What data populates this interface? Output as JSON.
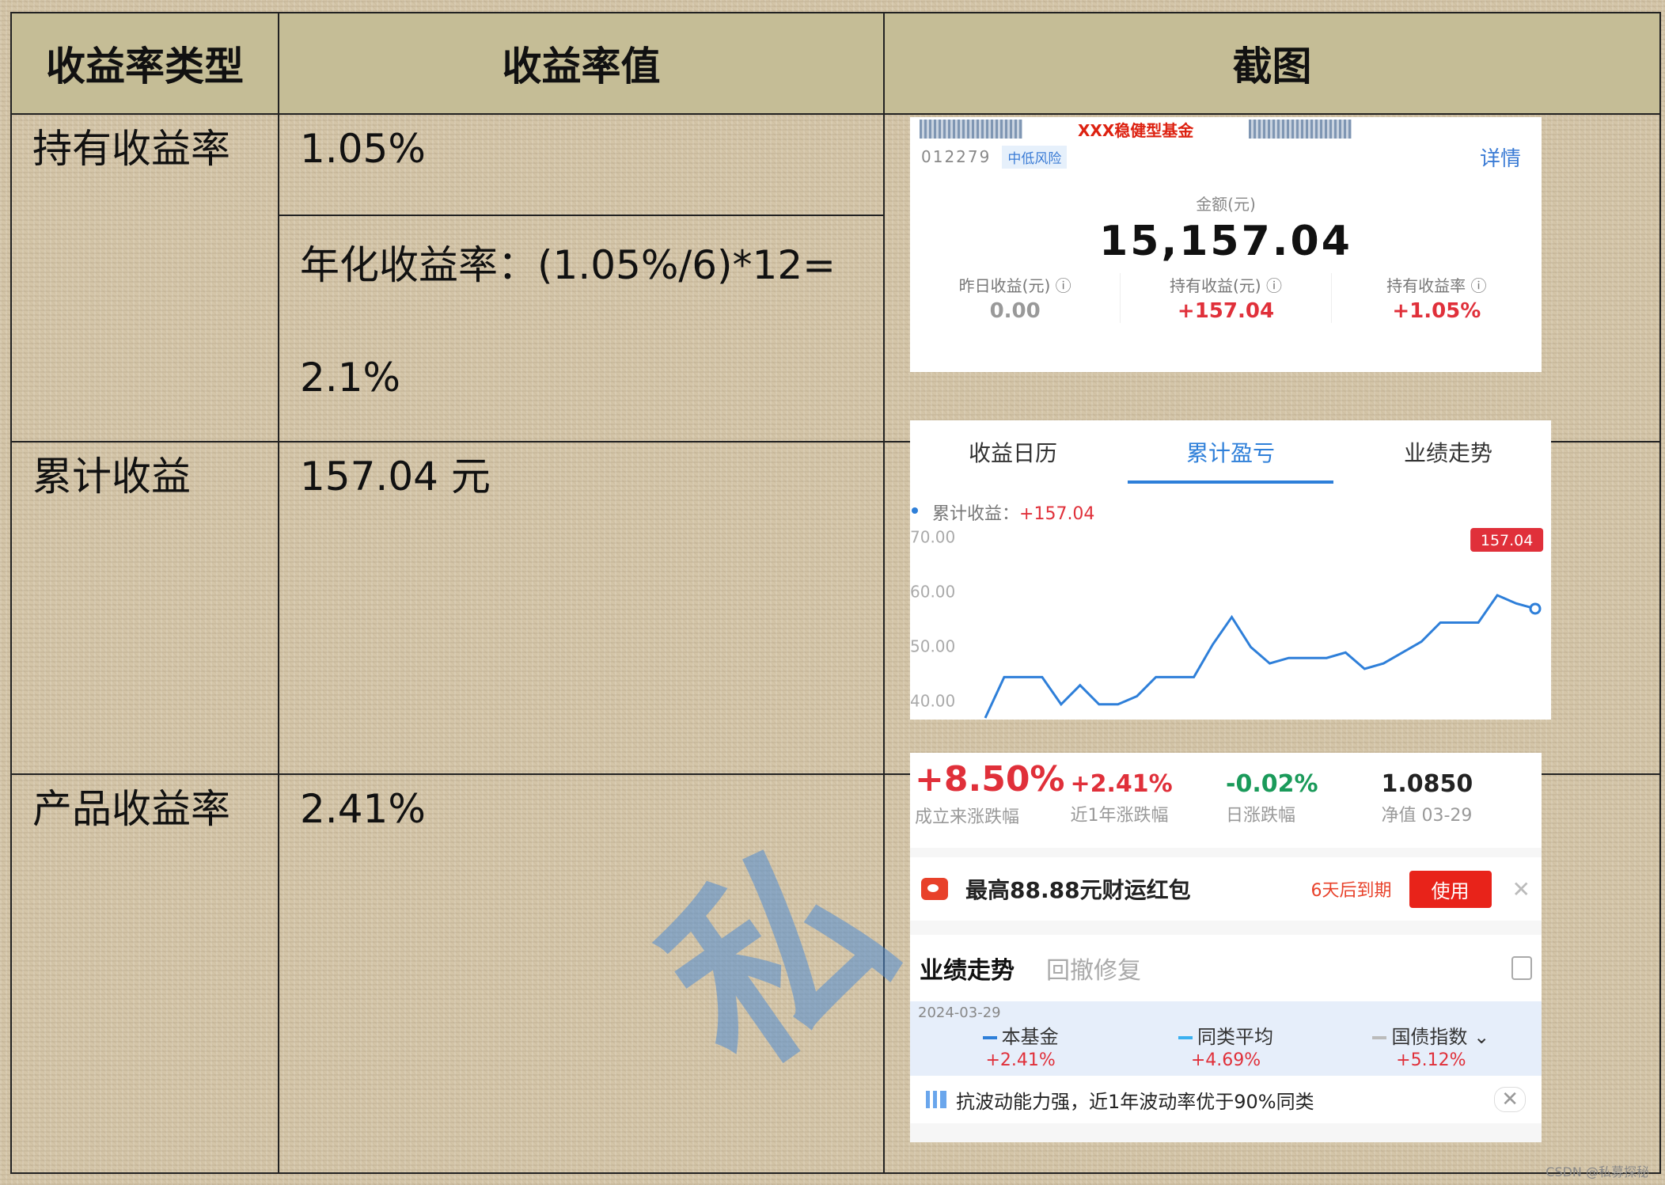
{
  "table": {
    "headers": [
      "收益率类型",
      "收益率值",
      "截图"
    ],
    "rows": [
      {
        "type": "持有收益率",
        "value1": "1.05%",
        "value2a": "年化收益率：(1.05%/6)*12=",
        "value2b": "2.1%"
      },
      {
        "type": "累计收益",
        "value": "157.04 元"
      },
      {
        "type": "产品收益率",
        "value": "2.41%"
      }
    ]
  },
  "shot1": {
    "fund_name": "XXX稳健型基金",
    "code": "012279",
    "risk": "中低风险",
    "detail": "详情",
    "amount_label": "金额(元)",
    "amount": "15,157.04",
    "stats": [
      {
        "label": "昨日收益(元) ⓘ",
        "value": "0.00",
        "color": "#999999"
      },
      {
        "label": "持有收益(元) ⓘ",
        "value": "+157.04",
        "color": "#e0303a"
      },
      {
        "label": "持有收益率 ⓘ",
        "value": "+1.05%",
        "color": "#e0303a"
      }
    ]
  },
  "shot2": {
    "tabs": [
      "收益日历",
      "累计盈亏",
      "业绩走势"
    ],
    "legend_label": "累计收益：",
    "legend_value": "+157.04",
    "chart_data": {
      "type": "line",
      "title": "",
      "xlabel": "",
      "ylabel": "",
      "ytick_labels": [
        "70.00",
        "60.00",
        "50.00",
        "40.00"
      ],
      "ylim": [
        137,
        173
      ],
      "x": [
        0,
        1,
        2,
        3,
        4,
        5,
        6,
        7,
        8,
        9,
        10,
        11,
        12,
        13,
        14,
        15,
        16,
        17,
        18,
        19,
        20,
        21,
        22,
        23,
        24,
        25,
        26,
        27,
        28,
        29
      ],
      "series": [
        {
          "values": [
            137,
            144.5,
            144.5,
            144.5,
            139.5,
            143,
            139.5,
            139.5,
            141,
            144.5,
            144.5,
            144.5,
            150.5,
            155.5,
            150,
            147,
            148,
            148,
            148,
            149,
            146,
            147,
            149,
            151,
            154.5,
            154.5,
            154.5,
            159.5,
            158,
            157.04
          ]
        }
      ],
      "callout": "157.04",
      "line_color": "#2e7fd9"
    }
  },
  "shot3": {
    "kpis": [
      {
        "value": "+8.50%",
        "label": "成立来涨跌幅",
        "color": "#e0303a"
      },
      {
        "value": "+2.41%",
        "label": "近1年涨跌幅",
        "color": "#e0303a"
      },
      {
        "value": "-0.02%",
        "label": "日涨跌幅",
        "color": "#1a9a5a"
      },
      {
        "value": "1.0850",
        "label": "净值 03-29",
        "color": "#222222"
      }
    ],
    "promo_text": "最高88.88元财运红包",
    "promo_expiry": "6天后到期",
    "promo_button": "使用",
    "close_glyph": "✕",
    "tabs": [
      "业绩走势",
      "回撤修复"
    ],
    "bench_date": "2024-03-29",
    "benchmarks": [
      {
        "name": "本基金",
        "pct": "+2.41%",
        "color": "#2e7fd9"
      },
      {
        "name": "同类平均",
        "pct": "+4.69%",
        "color": "#3ab0f0"
      },
      {
        "name": "国债指数 ⌄",
        "pct": "+5.12%",
        "color": "#bbbbbb"
      }
    ],
    "tip": "抗波动能力强，近1年波动率优于90%同类"
  },
  "watermark": "私",
  "credit": "CSDN @私募探秘"
}
